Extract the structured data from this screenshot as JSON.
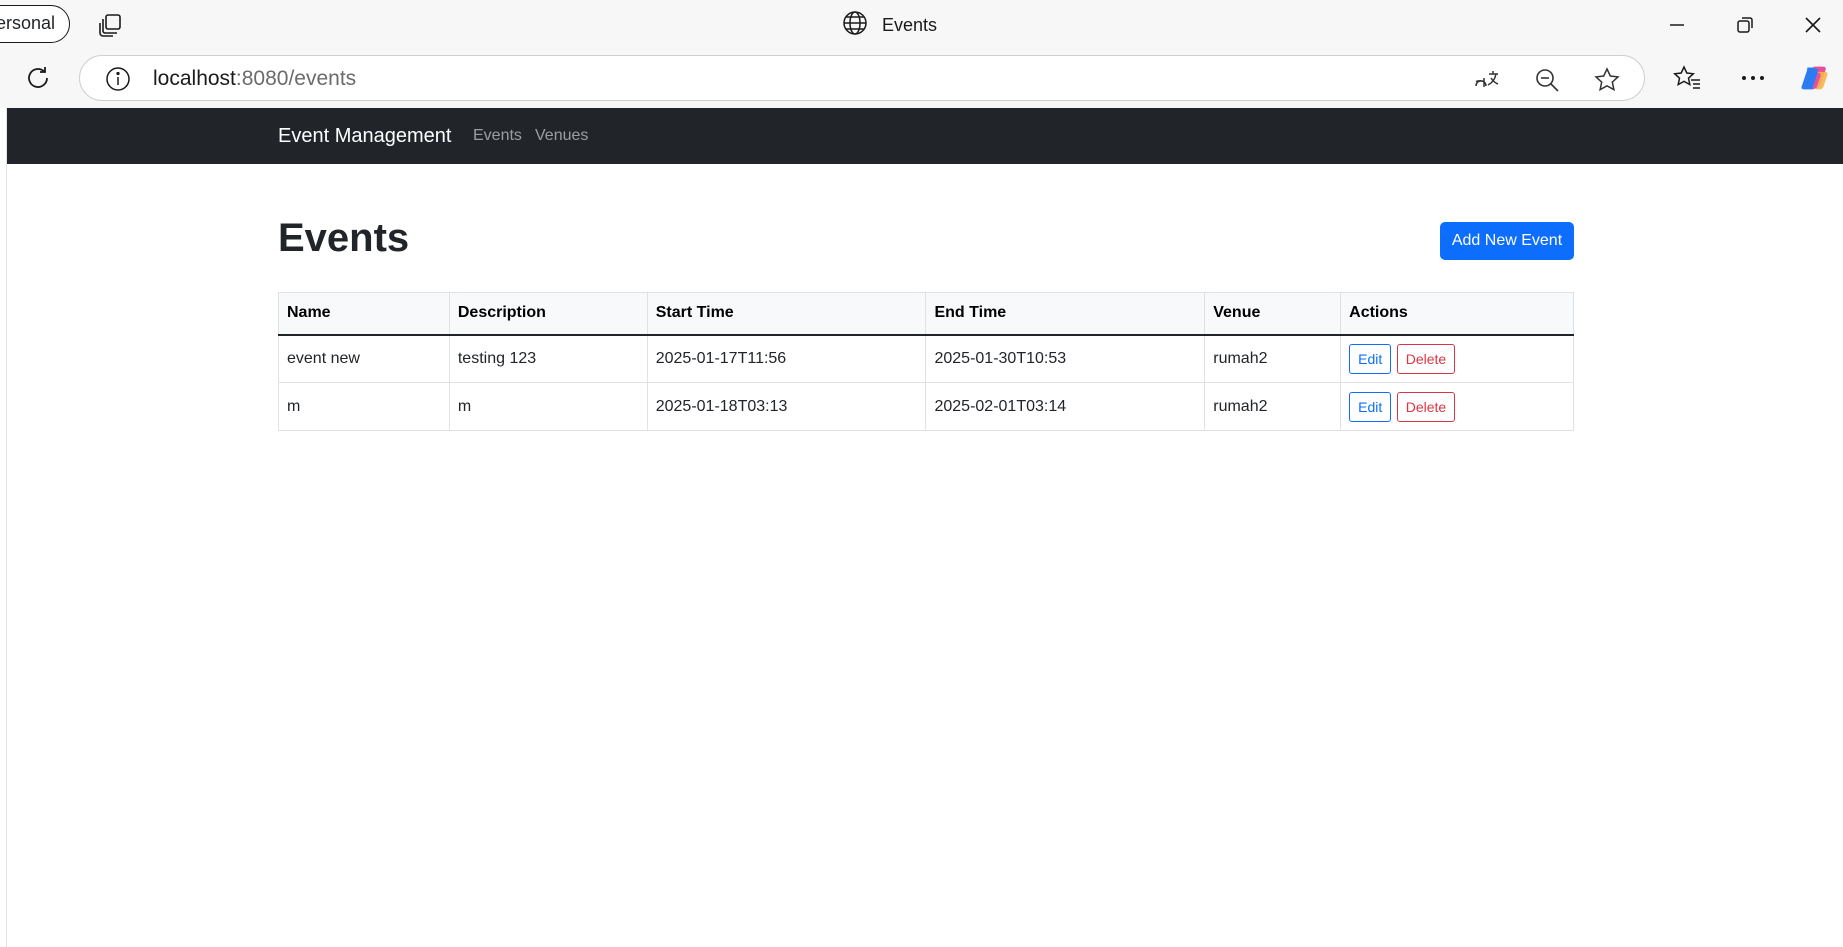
{
  "browser": {
    "profile_label": "ersonal",
    "tab_title": "Events",
    "url_host": "localhost",
    "url_rest": ":8080/events"
  },
  "navbar": {
    "brand": "Event Management",
    "links": [
      "Events",
      "Venues"
    ]
  },
  "page": {
    "title": "Events",
    "add_button": "Add New Event"
  },
  "table": {
    "headers": [
      "Name",
      "Description",
      "Start Time",
      "End Time",
      "Venue",
      "Actions"
    ],
    "rows": [
      {
        "name": "event new",
        "description": "testing 123",
        "start": "2025-01-17T11:56",
        "end": "2025-01-30T10:53",
        "venue": "rumah2"
      },
      {
        "name": "m",
        "description": "m",
        "start": "2025-01-18T03:13",
        "end": "2025-02-01T03:14",
        "venue": "rumah2"
      }
    ],
    "edit_label": "Edit",
    "delete_label": "Delete"
  },
  "colors": {
    "navbar_bg": "#212529",
    "primary": "#0d6efd",
    "danger": "#dc3545"
  }
}
